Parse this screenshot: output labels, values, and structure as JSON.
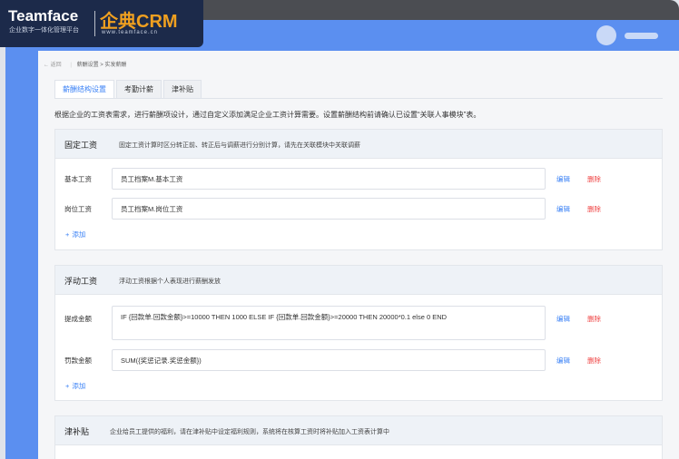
{
  "brand": {
    "name_en": "Teamface",
    "slogan": "企业数字一体化管理平台",
    "name_cn": "企典CRM",
    "url": "www.teamface.cn"
  },
  "breadcrumb": {
    "back": "← 返回",
    "parent": "薪酬设置",
    "current": "> 实发薪酬"
  },
  "tabs": [
    {
      "label": "薪酬结构设置",
      "active": true
    },
    {
      "label": "考勤计薪",
      "active": false
    },
    {
      "label": "津补贴",
      "active": false
    }
  ],
  "description": "根据企业的工资表需求，进行薪酬项设计，通过自定义添加满足企业工资计算需要。设置薪酬结构前请确认已设置“关联人事模块”表。",
  "sections": {
    "fixed": {
      "title": "固定工资",
      "note": "固定工资计算时区分转正前、转正后与调薪进行分别计算，请先在关联模块中关联调薪",
      "rows": [
        {
          "label": "基本工资",
          "value": "员工档案M.基本工资",
          "edit": "编辑",
          "delete": "删除"
        },
        {
          "label": "岗位工资",
          "value": "员工档案M.岗位工资",
          "edit": "编辑",
          "delete": "删除"
        }
      ],
      "add": "添加"
    },
    "floating": {
      "title": "浮动工资",
      "note": "浮动工资根据个人表现进行薪酬发放",
      "rows": [
        {
          "label": "提成金额",
          "value": "IF {回款单.回款金额}>=10000 THEN 1000 ELSE IF {回款单.回款金额}>=20000 THEN 20000*0.1 else 0 END",
          "edit": "编辑",
          "delete": "删除"
        },
        {
          "label": "罚款金额",
          "value": "SUM({奖惩记录.奖惩金额})",
          "edit": "编辑",
          "delete": "删除"
        }
      ],
      "add": "添加"
    },
    "allowance": {
      "title": "津补贴",
      "note": "企业给员工提供的福利，请在津补贴中设定福利规则，系统将在核算工资时将补贴加入工资表计算中"
    }
  },
  "colors": {
    "primary": "#5b8ff0",
    "link": "#3b82f6",
    "danger": "#ef4444",
    "logo_bg": "#1c2a4a",
    "logo_accent": "#f0a020"
  }
}
